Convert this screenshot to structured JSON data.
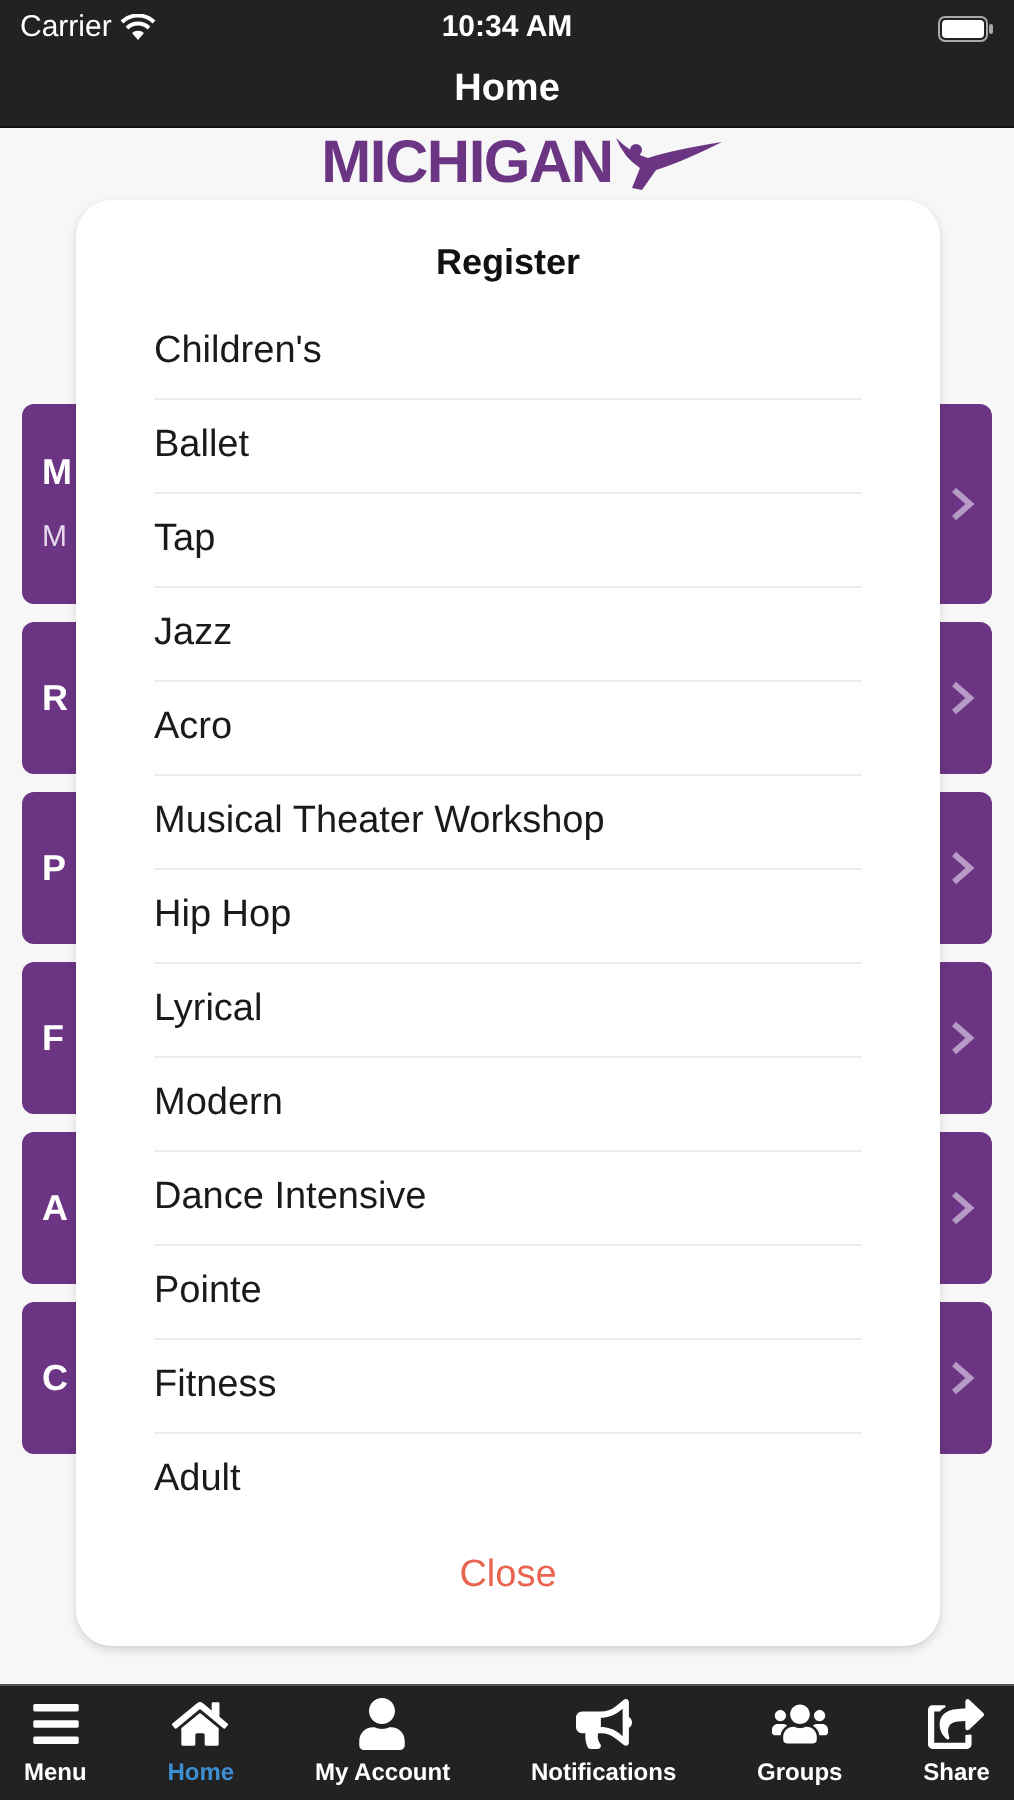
{
  "status_bar": {
    "carrier": "Carrier",
    "time": "10:34 AM"
  },
  "nav_bar": {
    "title": "Home"
  },
  "logo": {
    "text": "MICHIGAN"
  },
  "cards": [
    {
      "title": "M",
      "subtitle": "M"
    },
    {
      "title": "R"
    },
    {
      "title": "P"
    },
    {
      "title": "F"
    },
    {
      "title": "A"
    },
    {
      "title": "C"
    }
  ],
  "dialog": {
    "title": "Register",
    "items": [
      "Children's",
      "Ballet",
      "Tap",
      "Jazz",
      "Acro",
      "Musical Theater Workshop",
      "Hip Hop",
      "Lyrical",
      "Modern",
      "Dance Intensive",
      "Pointe",
      "Fitness",
      "Adult"
    ],
    "close": "Close"
  },
  "tab_bar": [
    {
      "label": "Menu",
      "selected": false
    },
    {
      "label": "Home",
      "selected": true
    },
    {
      "label": "My Account",
      "selected": false
    },
    {
      "label": "Notifications",
      "selected": false
    },
    {
      "label": "Groups",
      "selected": false
    },
    {
      "label": "Share",
      "selected": false
    }
  ]
}
